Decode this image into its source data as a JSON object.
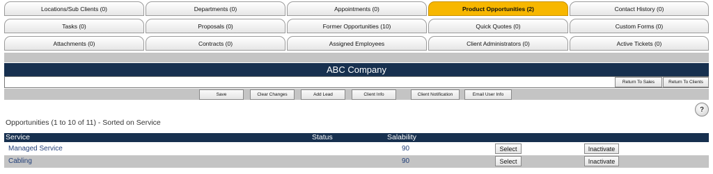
{
  "tabs": {
    "row1": [
      "Locations/Sub Clients  (0)",
      "Departments (0)",
      "Appointments (0)",
      "Product Opportunities (2)",
      "Contact History (0)"
    ],
    "row2": [
      "Tasks (0)",
      "Proposals (0)",
      "Former Opportunities (10)",
      "Quick Quotes (0)",
      "Custom Forms (0)"
    ],
    "row3": [
      "Attachments (0)",
      "Contracts (0)",
      "Assigned Employees",
      "Client Administrators (0)",
      "Active Tickets (0)"
    ],
    "active": "Product Opportunities (2)"
  },
  "company": {
    "name": "ABC Company"
  },
  "return_buttons": {
    "sales": "Return To Sales",
    "clients": "Return To Clients"
  },
  "actions": {
    "save": "Save",
    "clear": "Clear Changes",
    "add_lead": "Add Lead",
    "client_info": "Client Info",
    "client_notification": "Client Notification",
    "email_user_info": "Email User Info"
  },
  "help": {
    "label": "?"
  },
  "opportunities": {
    "title": "Opportunities (1 to 10 of 11) - Sorted on Service",
    "columns": {
      "service": "Service",
      "status": "Status",
      "salability": "Salability"
    },
    "rows": [
      {
        "service": "Managed Service",
        "status": "",
        "salability": "90",
        "select": "Select",
        "inactivate": "Inactivate"
      },
      {
        "service": "Cabling",
        "status": "",
        "salability": "90",
        "select": "Select",
        "inactivate": "Inactivate"
      }
    ]
  },
  "colors": {
    "navy": "#17304f",
    "active_tab": "#f7b700",
    "band_gray": "#c4c4c4",
    "link": "#23407a",
    "alt_row": "#c4c4c4"
  }
}
